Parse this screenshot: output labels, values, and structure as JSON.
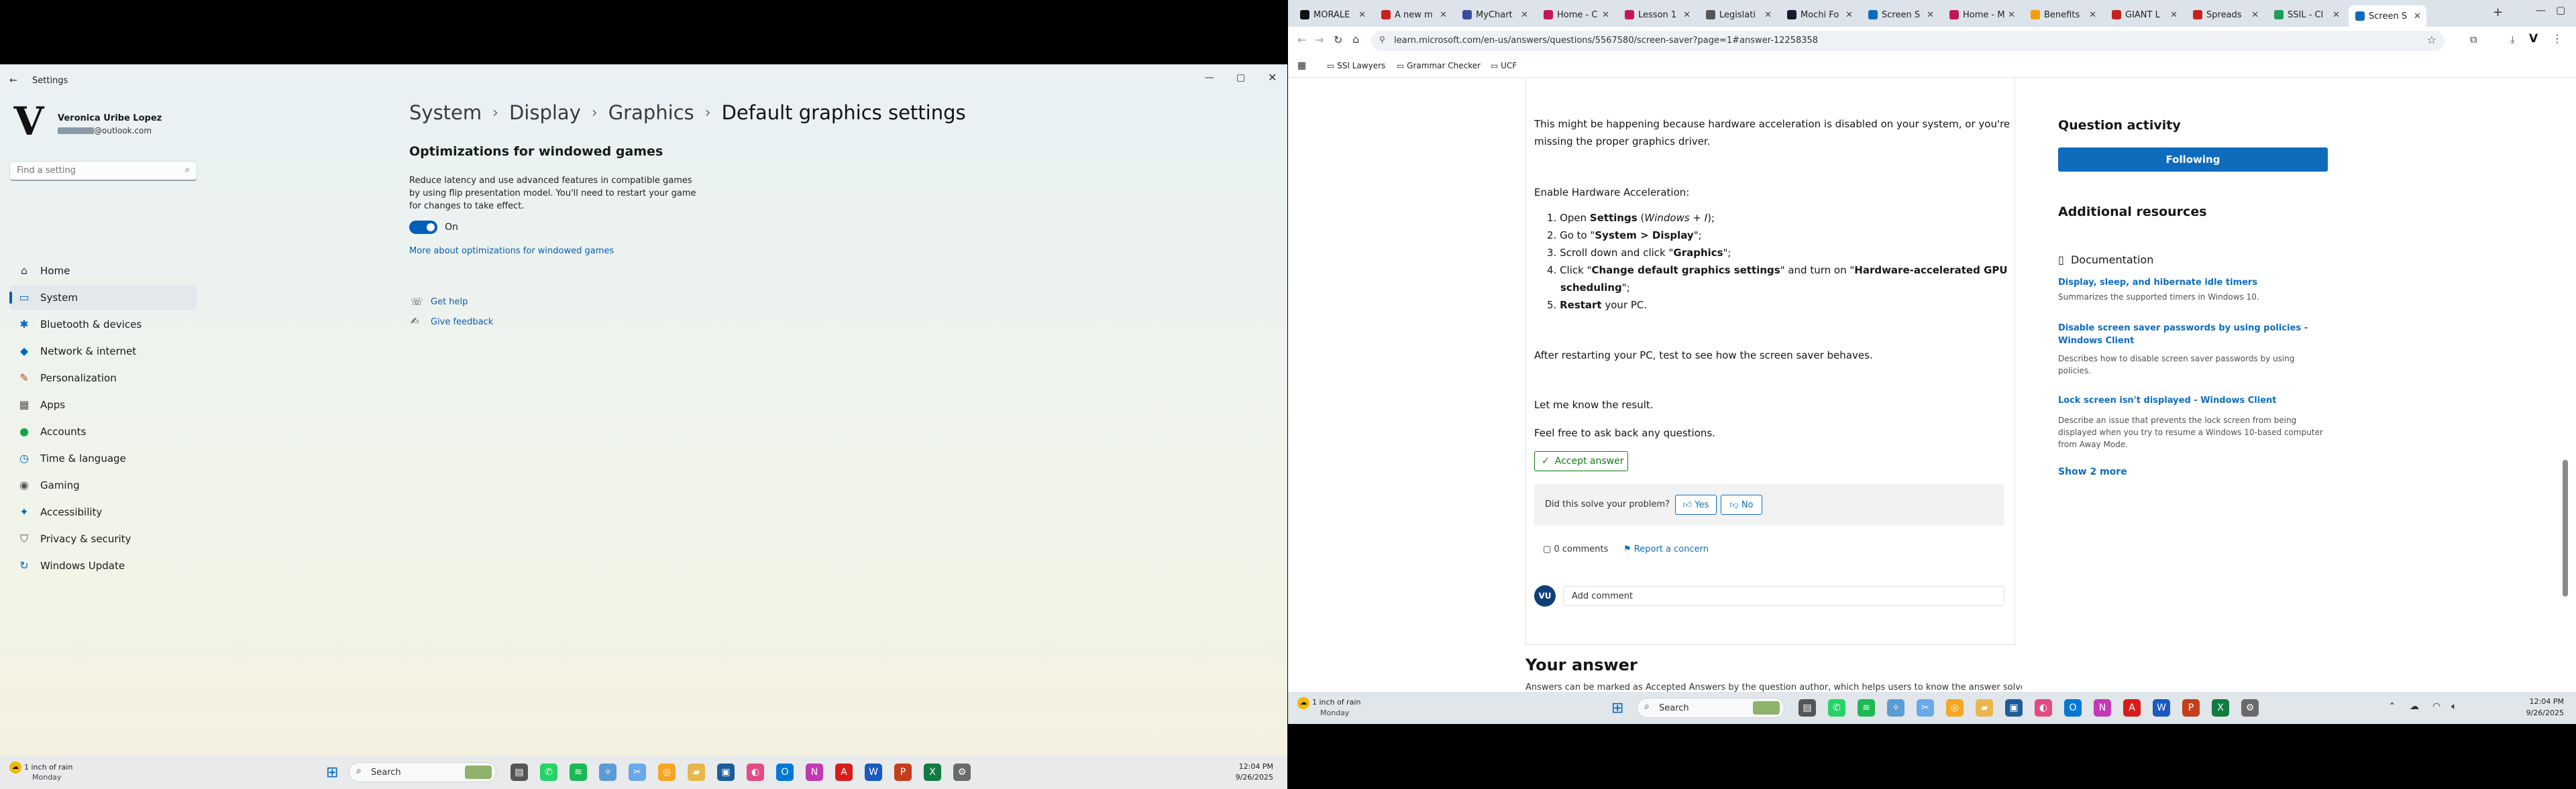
{
  "settings": {
    "app_title": "Settings",
    "user_name": "Veronica Uribe Lopez",
    "user_email": "@outlook.com",
    "search_placeholder": "Find a setting",
    "nav": [
      {
        "label": "Home",
        "icon": "home-icon",
        "glyph": "⌂",
        "color": "#444"
      },
      {
        "label": "System",
        "icon": "system-icon",
        "glyph": "▭",
        "color": "#0067c0"
      },
      {
        "label": "Bluetooth & devices",
        "icon": "bluetooth-icon",
        "glyph": "✱",
        "color": "#0067c0"
      },
      {
        "label": "Network & internet",
        "icon": "network-icon",
        "glyph": "◆",
        "color": "#0067c0"
      },
      {
        "label": "Personalization",
        "icon": "brush-icon",
        "glyph": "✎",
        "color": "#c2410c"
      },
      {
        "label": "Apps",
        "icon": "apps-icon",
        "glyph": "▦",
        "color": "#555"
      },
      {
        "label": "Accounts",
        "icon": "accounts-icon",
        "glyph": "●",
        "color": "#16a34a"
      },
      {
        "label": "Time & language",
        "icon": "clock-icon",
        "glyph": "◷",
        "color": "#0067c0"
      },
      {
        "label": "Gaming",
        "icon": "gaming-icon",
        "glyph": "◉",
        "color": "#555"
      },
      {
        "label": "Accessibility",
        "icon": "accessibility-icon",
        "glyph": "✦",
        "color": "#0067c0"
      },
      {
        "label": "Privacy & security",
        "icon": "shield-icon",
        "glyph": "⛉",
        "color": "#555"
      },
      {
        "label": "Windows Update",
        "icon": "update-icon",
        "glyph": "↻",
        "color": "#0067c0"
      }
    ],
    "breadcrumb": [
      "System",
      "Display",
      "Graphics",
      "Default graphics settings"
    ],
    "section_title": "Optimizations for windowed games",
    "section_desc": "Reduce latency and use advanced features in compatible games by using flip presentation model. You'll need to restart your game for changes to take effect.",
    "toggle_label": "On",
    "more_link": "More about optimizations for windowed games",
    "get_help": "Get help",
    "give_feedback": "Give feedback"
  },
  "taskbar_left": {
    "weather_temp": "1 inch of rain",
    "weather_day": "Monday",
    "search_label": "Search",
    "time": "12:04 PM",
    "date": "9/26/2025"
  },
  "browser": {
    "tabs": [
      "MORALE",
      "A new m",
      "MyChart",
      "Home - C",
      "Lesson 1",
      "Legislati",
      "Mochi Fo",
      "Screen S",
      "Home - M",
      "Benefits",
      "GIANT L",
      "Spreads",
      "SSIL - Cl",
      "Screen S"
    ],
    "url": "learn.microsoft.com/en-us/answers/questions/5567580/screen-saver?page=1#answer-12258358",
    "bookmarks": [
      "SSI Lawyers",
      "Grammar Checker",
      "UCF"
    ]
  },
  "answer": {
    "intro": "This might be happening because hardware acceleration is disabled on your system, or you're missing the proper graphics driver.",
    "enable_heading": "Enable Hardware Acceleration:",
    "steps": [
      "1. Open Settings (Windows + I);",
      "2. Go to \"System > Display\";",
      "3. Scroll down and click \"Graphics\";",
      "4. Click \"Change default graphics settings\" and turn on \"Hardware-accelerated GPU",
      "scheduling\";",
      "5. Restart your PC."
    ],
    "after_restart": "After restarting your PC, test to see how the screen saver behaves.",
    "let_me_know": "Let me know the result.",
    "feel_free": "Feel free to ask back any questions.",
    "accept_label": "Accept answer",
    "solve_question": "Did this solve your problem?",
    "yes_label": "Yes",
    "no_label": "No",
    "comments_label": "0 comments",
    "report_label": "Report a concern",
    "avatar_initials": "VU",
    "add_comment": "Add comment",
    "your_answer": "Your answer",
    "answers_note": "Answers can be marked as Accepted Answers by the question author, which helps users to know the answer solved the"
  },
  "sidebar_right": {
    "question_activity": "Question activity",
    "following_label": "Following",
    "additional_resources": "Additional resources",
    "documentation": "Documentation",
    "docs": [
      {
        "title": "Display, sleep, and hibernate idle timers",
        "desc": "Summarizes the supported timers in Windows 10."
      },
      {
        "title": "Disable screen saver passwords by using policies - Windows Client",
        "desc": "Describes how to disable screen saver passwords by using policies."
      },
      {
        "title": "Lock screen isn't displayed - Windows Client",
        "desc": "Describe an issue that prevents the lock screen from being displayed when you try to resume a Windows 10-based computer from Away Mode."
      }
    ],
    "show_more": "Show 2 more"
  },
  "taskbar_right": {
    "weather_temp": "1 inch of rain",
    "weather_day": "Monday",
    "search_label": "Search",
    "time": "12:04 PM",
    "date": "9/26/2025"
  }
}
